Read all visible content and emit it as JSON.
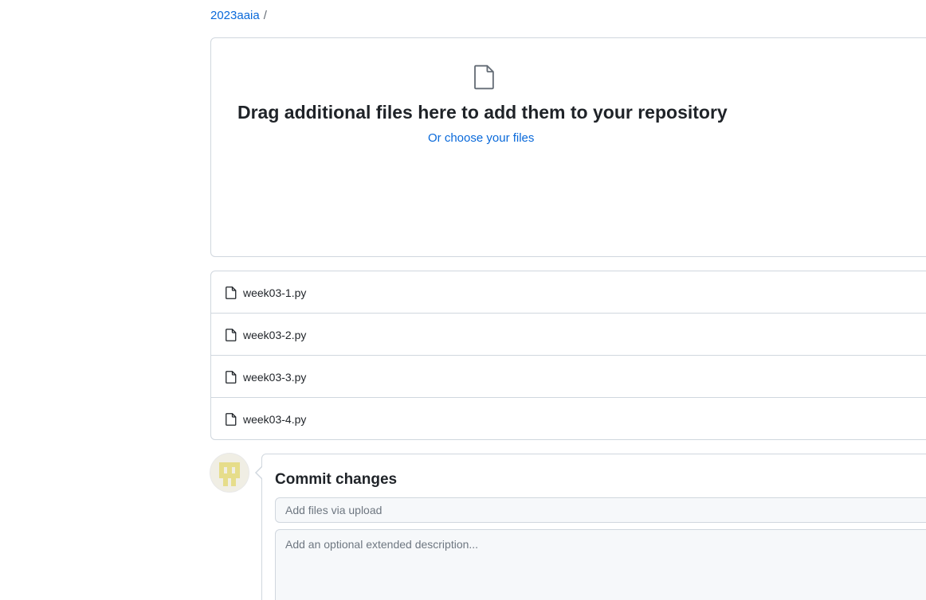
{
  "breadcrumb": {
    "repo": "2023aaia",
    "separator": "/"
  },
  "dropzone": {
    "icon": "file-icon",
    "title": "Drag additional files here to add them to your repository",
    "or_text": "Or",
    "choose_link": "choose your files"
  },
  "files": [
    {
      "name": "week03-1.py",
      "icon": "file-icon"
    },
    {
      "name": "week03-2.py",
      "icon": "file-icon"
    },
    {
      "name": "week03-3.py",
      "icon": "file-icon"
    },
    {
      "name": "week03-4.py",
      "icon": "file-icon"
    }
  ],
  "commit": {
    "title": "Commit changes",
    "summary_placeholder": "Add files via upload",
    "description_placeholder": "Add an optional extended description..."
  },
  "colors": {
    "link": "#0969da",
    "border": "#d0d7de",
    "input_bg": "#f6f8fa",
    "avatar_fg": "#e6dd8a"
  }
}
